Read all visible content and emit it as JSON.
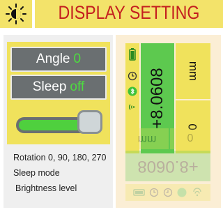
{
  "header": {
    "title": "DISPLAY SETTING",
    "icon": "brightness-icon"
  },
  "settings": {
    "angle_label": "Angle",
    "angle_value": "0",
    "sleep_label": "Sleep",
    "sleep_value": "off",
    "brightness_level": 0.78
  },
  "captions": {
    "rotation": "Rotation  0, 90, 180, 270",
    "sleep": "Sleep mode",
    "brightness": "Brightness level"
  },
  "preview": {
    "main_value": "+8.0608",
    "unit": "mm",
    "zero": "0",
    "mirrored_main": "+8.0608",
    "mirrored_unit": "mm",
    "mirrored_zero": "0",
    "icons": [
      "battery-icon",
      "clock-icon",
      "bluetooth-icon",
      "signal-wave-icon"
    ]
  },
  "colors": {
    "accent_yellow": "#f0e25c",
    "header_red": "#c41f1f",
    "value_green": "#4ddc3f",
    "display_green": "#5dc94f",
    "button_gray": "#6a6f71"
  }
}
